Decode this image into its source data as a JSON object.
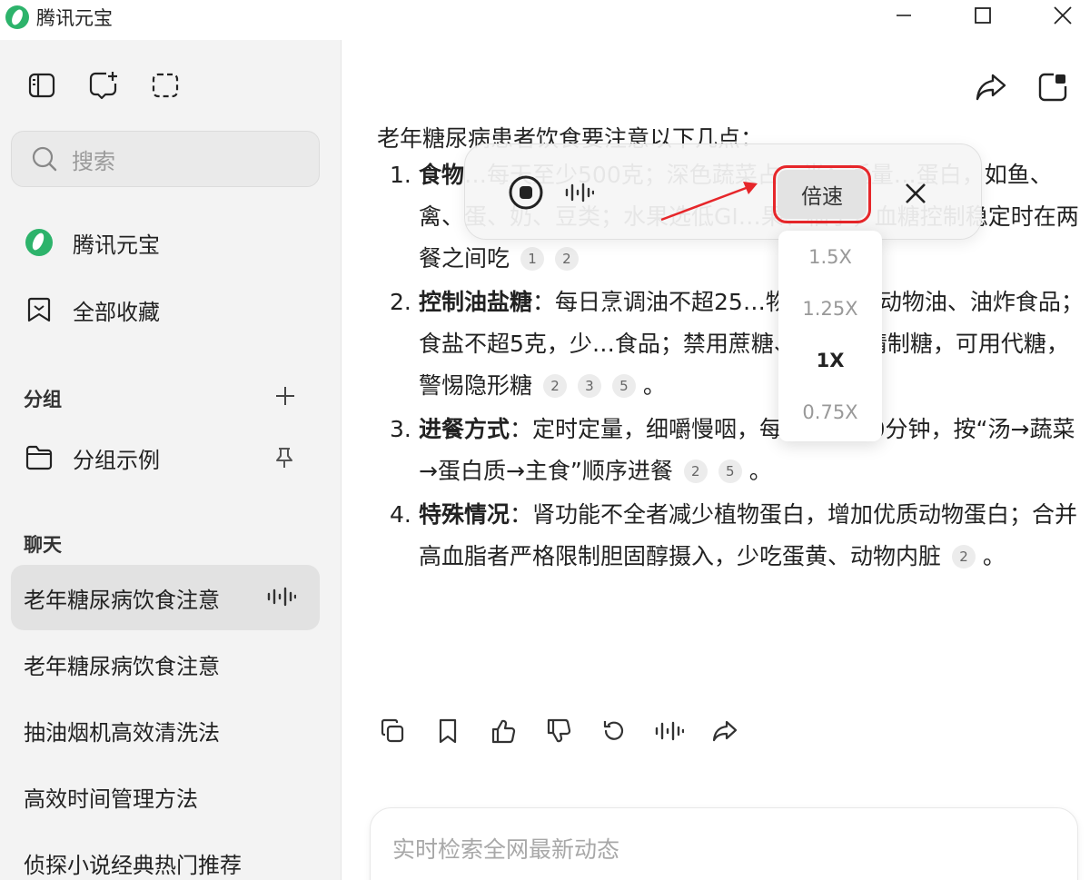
{
  "window": {
    "title": "腾讯元宝"
  },
  "sidebar": {
    "search_placeholder": "搜索",
    "nav": [
      {
        "label": "腾讯元宝",
        "icon": "yuanbao-logo-icon"
      },
      {
        "label": "全部收藏",
        "icon": "bookmark-icon"
      }
    ],
    "groups": {
      "title": "分组",
      "items": [
        {
          "label": "分组示例"
        }
      ]
    },
    "chats": {
      "title": "聊天",
      "items": [
        {
          "label": "老年糖尿病饮食注意",
          "active": true
        },
        {
          "label": "老年糖尿病饮食注意"
        },
        {
          "label": "抽油烟机高效清洗法"
        },
        {
          "label": "高效时间管理方法"
        },
        {
          "label": "侦探小说经典热门推荐"
        }
      ]
    }
  },
  "message": {
    "lead": "老年糖尿病患者饮食要注意以下几点：",
    "items": [
      {
        "num": "1.",
        "title": "食物",
        "text": "…每天至少500克；深色蔬菜占一半；适量…蛋白，如鱼、禽、蛋、奶、豆类；水果选低GI…果、柚子，血糖控制稳定时在两餐之间吃",
        "cites": [
          "1",
          "2"
        ]
      },
      {
        "num": "2.",
        "title": "控制油盐糖",
        "text": "：每日烹调油不超25…物油，少吃动物油、油炸食品；食盐不超5克，少…食品；禁用蔗糖、红糖等精制糖，可用代糖，警惕隐形糖",
        "cites": [
          "2",
          "3",
          "5"
        ]
      },
      {
        "num": "3.",
        "title": "进餐方式",
        "text": "：定时定量，细嚼慢咽，每餐20 - 30分钟，按“汤→蔬菜→蛋白质→主食”顺序进餐",
        "cites": [
          "2",
          "5"
        ]
      },
      {
        "num": "4.",
        "title": "特殊情况",
        "text": "：肾功能不全者减少植物蛋白，增加优质动物蛋白；合并高血脂者严格限制胆固醇摄入，少吃蛋黄、动物内脏",
        "cites": [
          "2"
        ]
      }
    ],
    "end_mark": "。"
  },
  "input": {
    "placeholder": "实时检索全网最新动态"
  },
  "playback": {
    "speed_label": "倍速",
    "speed_options": [
      "1.5X",
      "1.25X",
      "1X",
      "0.75X"
    ],
    "selected_speed": "1X"
  },
  "colors": {
    "accent_green": "#2db36b",
    "highlight_red": "#e6262a"
  }
}
